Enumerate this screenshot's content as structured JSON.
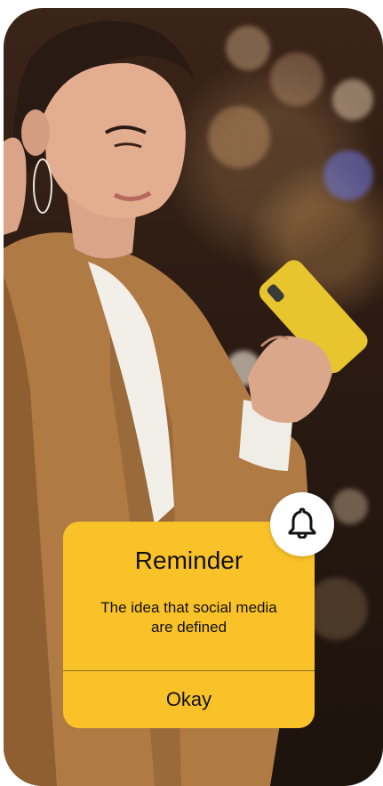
{
  "reminder": {
    "title": "Reminder",
    "message": "The idea that social media are defined",
    "button_label": "Okay",
    "icon": "bell-icon"
  },
  "colors": {
    "card": "#f9c229",
    "badge": "#ffffff",
    "text": "#111111"
  }
}
